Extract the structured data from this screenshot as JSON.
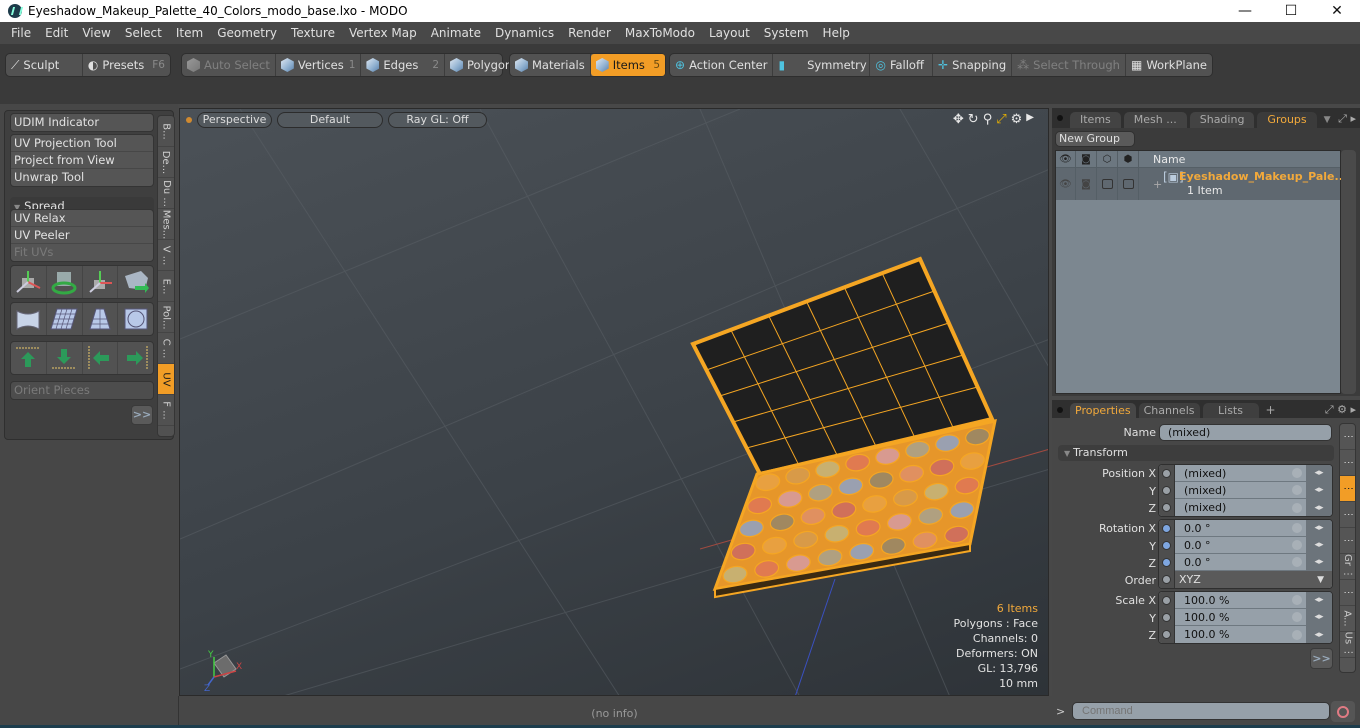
{
  "window": {
    "title": "Eyeshadow_Makeup_Palette_40_Colors_modo_base.lxo - MODO",
    "controls": {
      "minimize": "—",
      "maximize": "☐",
      "close": "✕"
    }
  },
  "menubar": [
    "File",
    "Edit",
    "View",
    "Select",
    "Item",
    "Geometry",
    "Texture",
    "Vertex Map",
    "Animate",
    "Dynamics",
    "Render",
    "MaxToModo",
    "Layout",
    "System",
    "Help"
  ],
  "toolbar": {
    "sculpt": "Sculpt",
    "presets": "Presets",
    "presets_key": "F6",
    "auto_select": "Auto Select",
    "vertices": "Vertices",
    "vertices_key": "1",
    "edges": "Edges",
    "edges_key": "2",
    "polygons": "Polygons",
    "materials": "Materials",
    "items": "Items",
    "items_key": "5",
    "action_center": "Action Center",
    "symmetry": "Symmetry",
    "falloff": "Falloff",
    "snapping": "Snapping",
    "select_through": "Select Through",
    "workplane": "WorkPlane"
  },
  "left_panel": {
    "udim": "UDIM Indicator",
    "tools": [
      "UV Projection Tool",
      "Project from View",
      "Unwrap Tool"
    ],
    "spread": "Spread",
    "relax_tools": [
      "UV Relax",
      "UV Peeler",
      "Fit UVs"
    ],
    "icon_row_1": [
      "move-uv-icon",
      "rotate-uv-icon",
      "transform-uv-icon",
      "mirror-uv-icon"
    ],
    "icon_row_2": [
      "wrap-uv-icon",
      "grid-uv-icon",
      "taper-uv-icon",
      "sphere-uv-icon"
    ],
    "align_icons": [
      "align-top-icon",
      "align-bottom-icon",
      "align-left-icon",
      "align-right-icon"
    ],
    "orient_pieces": "Orient Pieces",
    "more": ">>",
    "side_tabs": [
      "B...",
      "De...",
      "Du ...",
      "Mes...",
      "V ...",
      "E...",
      "Pol...",
      "C ...",
      "UV",
      "F ..."
    ],
    "active_side_tab": "UV"
  },
  "viewport": {
    "view_mode": "Perspective",
    "shading": "Default",
    "raygl": "Ray GL: Off",
    "info": {
      "items": "6 Items",
      "polygons": "Polygons : Face",
      "channels": "Channels: 0",
      "deformers": "Deformers: ON",
      "gl": "GL: 13,796",
      "unit": "10 mm"
    },
    "axis": {
      "x": "X",
      "y": "Y",
      "z": "Z"
    }
  },
  "groups_panel": {
    "tabs": [
      "Items",
      "Mesh ...",
      "Shading",
      "Groups"
    ],
    "active_tab": "Groups",
    "new_group": "New Group",
    "column_name": "Name",
    "row": {
      "name": "Eyeshadow_Makeup_Pale...",
      "count": "1 Item",
      "expand": "+"
    }
  },
  "properties_panel": {
    "tabs": [
      "Properties",
      "Channels",
      "Lists"
    ],
    "active_tab": "Properties",
    "add_tab": "+",
    "name_label": "Name",
    "name_value": "(mixed)",
    "section": "Transform",
    "position": {
      "label_x": "Position X",
      "x": "(mixed)",
      "y": "(mixed)",
      "z": "(mixed)"
    },
    "rotation": {
      "label_x": "Rotation X",
      "x": "0.0 °",
      "y": "0.0 °",
      "z": "0.0 °"
    },
    "order": {
      "label": "Order",
      "value": "XYZ"
    },
    "scale": {
      "label_x": "Scale X",
      "x": "100.0 %",
      "y": "100.0 %",
      "z": "100.0 %"
    },
    "axis_y": "Y",
    "axis_z": "Z",
    "more": ">>",
    "side_tabs": [
      "⋮",
      "⋮",
      "⋮",
      "⋮",
      "⋮",
      "Gr ⋮",
      "⋮",
      "A...",
      "Us ⋮",
      "⋮"
    ],
    "active_side_tab_index": 2
  },
  "statusbar": {
    "info": "(no info)",
    "command_prompt": ">",
    "command_placeholder": "Command"
  },
  "colors": {
    "accent": "#f29d26",
    "selection_wire": "#f5a623",
    "viewport_bg": "#3e4449"
  }
}
